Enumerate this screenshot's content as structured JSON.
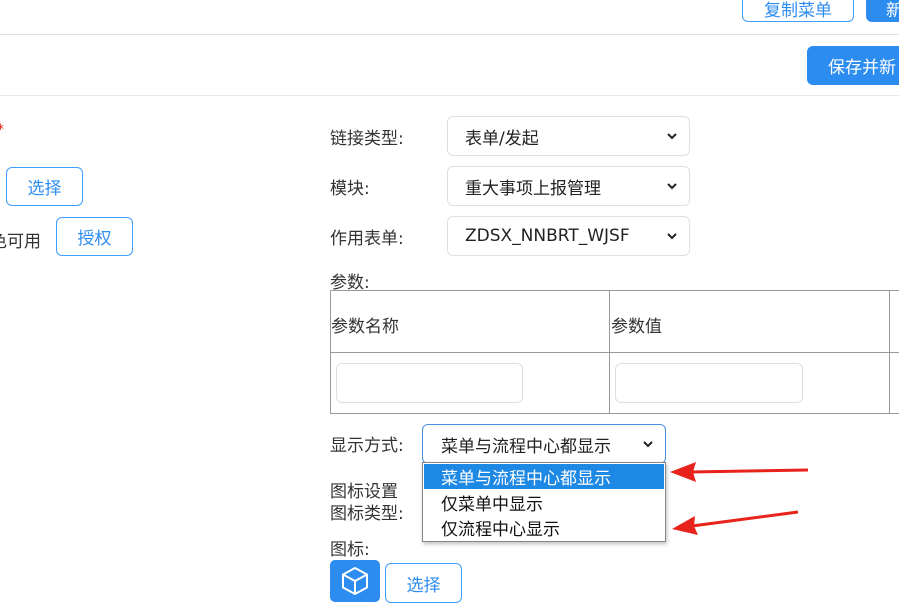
{
  "toolbar": {
    "copy_menu_label": "复制菜单",
    "new_label_partial": "新",
    "save_new_label": "保存并新"
  },
  "left": {
    "required_mark": "*",
    "select_button": "选择",
    "available_text": "色可用",
    "authorize_button": "授权"
  },
  "form": {
    "link_type_label": "链接类型:",
    "link_type_value": "表单/发起",
    "module_label": "模块:",
    "module_value": "重大事项上报管理",
    "form_label": "作用表单:",
    "form_value": "ZDSX_NNBRT_WJSF",
    "params_label": "参数:",
    "params_table": {
      "headers": [
        "参数名称",
        "参数值"
      ],
      "rows": [
        [
          "",
          ""
        ]
      ]
    },
    "display_label": "显示方式:",
    "display_value": "菜单与流程中心都显示",
    "display_options": [
      "菜单与流程中心都显示",
      "仅菜单中显示",
      "仅流程中心显示"
    ],
    "icon_settings_label": "图标设置",
    "icon_type_label": "图标类型:",
    "icon_label": "图标:",
    "icon_select_button": "选择"
  },
  "colors": {
    "accent": "#2d8cf0",
    "selected_option_bg": "#1e88e5",
    "annotation_arrow": "#e8231b",
    "required": "#e8231b"
  },
  "icons": {
    "cube": "cube-icon",
    "chevron": "chevron-down-icon"
  }
}
